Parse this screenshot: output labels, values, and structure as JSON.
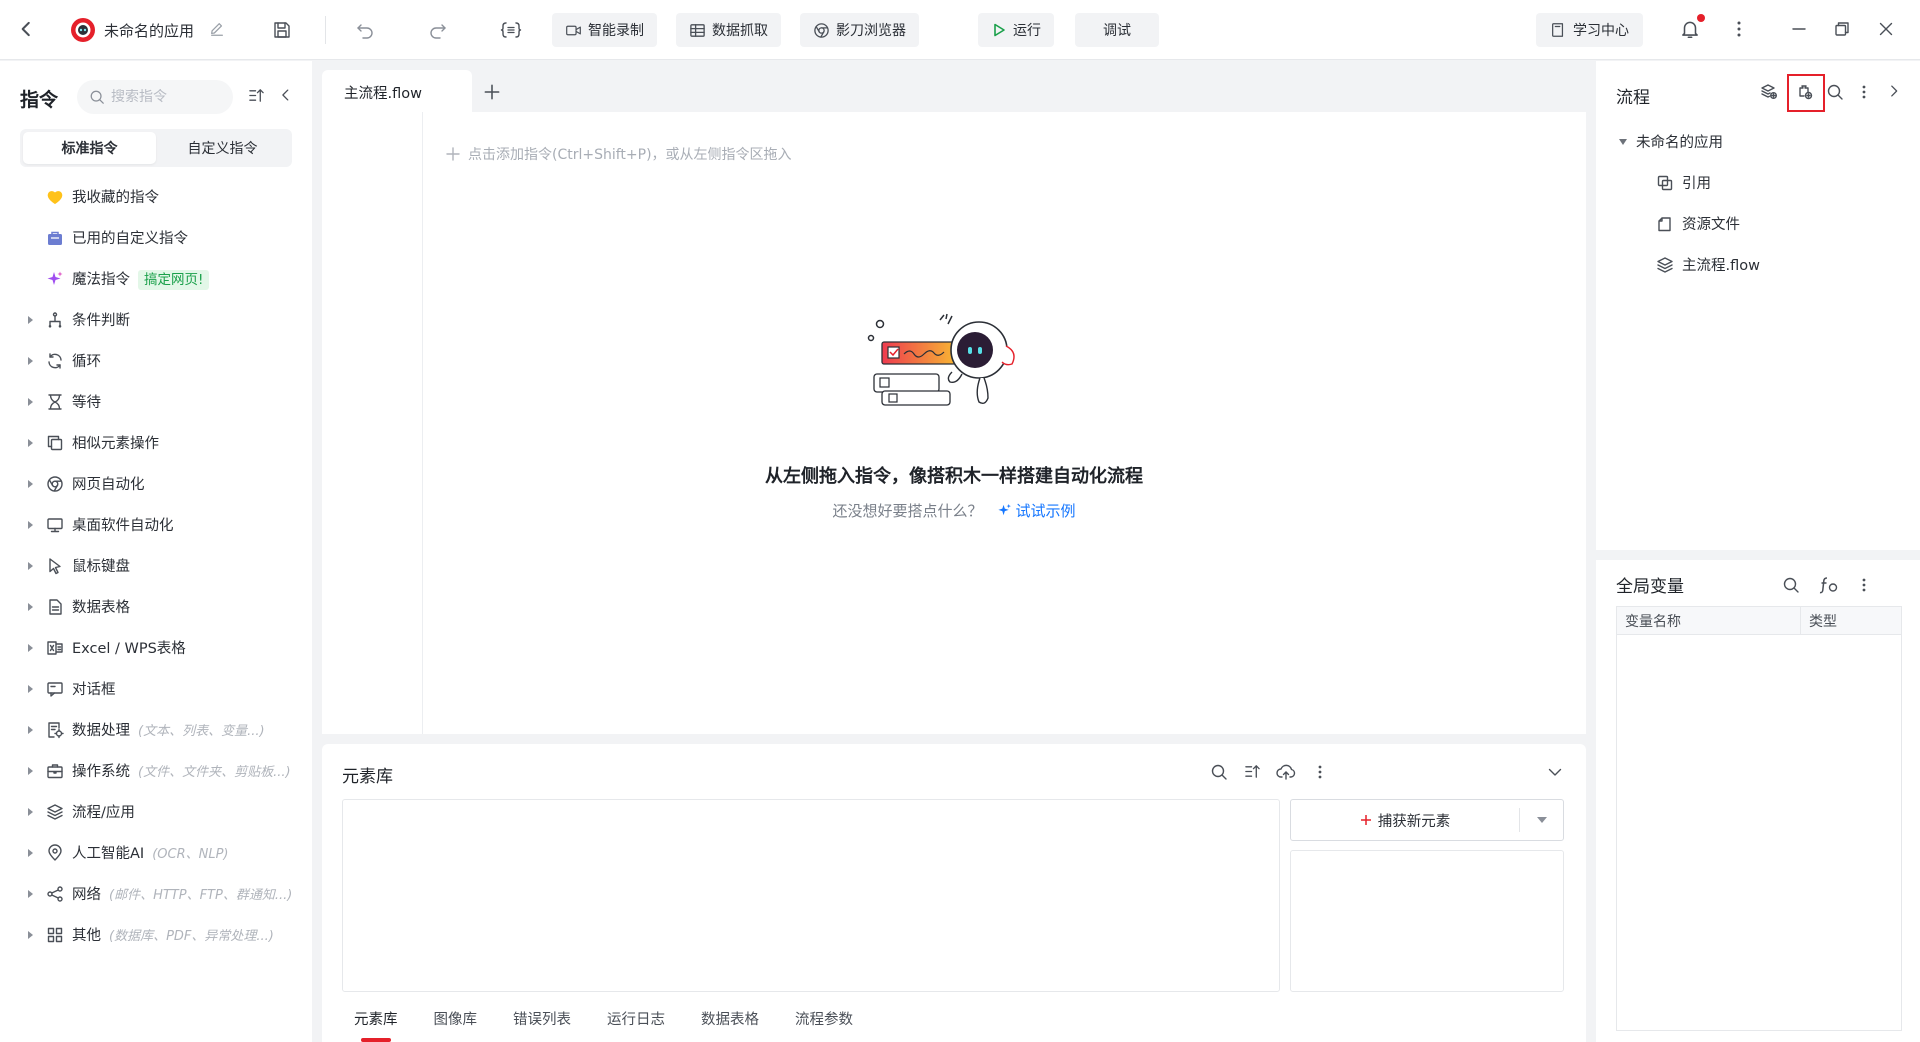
{
  "topbar": {
    "app_title": "未命名的应用",
    "buttons": {
      "smart_record": "智能录制",
      "data_capture": "数据抓取",
      "browser": "影刀浏览器",
      "run": "运行",
      "debug": "调试",
      "learning_center": "学习中心"
    },
    "notification_badge": true,
    "colors": {
      "accent": "#e5202a",
      "run_icon": "#1aa04a"
    }
  },
  "left_panel": {
    "title": "指令",
    "search_placeholder": "搜索指令",
    "segments": [
      "标准指令",
      "自定义指令"
    ],
    "active_segment": 0,
    "items": [
      {
        "label": "我收藏的指令",
        "icon": "heart-icon",
        "expandable": false
      },
      {
        "label": "已用的自定义指令",
        "icon": "bag-icon",
        "expandable": false
      },
      {
        "label": "魔法指令",
        "icon": "sparkle-icon",
        "expandable": false,
        "tag": "搞定网页!"
      },
      {
        "label": "条件判断",
        "icon": "branch-icon",
        "expandable": true
      },
      {
        "label": "循环",
        "icon": "loop-icon",
        "expandable": true
      },
      {
        "label": "等待",
        "icon": "hourglass-icon",
        "expandable": true
      },
      {
        "label": "相似元素操作",
        "icon": "copy-icon",
        "expandable": true
      },
      {
        "label": "网页自动化",
        "icon": "browser-icon",
        "expandable": true
      },
      {
        "label": "桌面软件自动化",
        "icon": "monitor-icon",
        "expandable": true
      },
      {
        "label": "鼠标键盘",
        "icon": "cursor-icon",
        "expandable": true
      },
      {
        "label": "数据表格",
        "icon": "document-icon",
        "expandable": true
      },
      {
        "label": "Excel / WPS表格",
        "icon": "excel-icon",
        "expandable": true
      },
      {
        "label": "对话框",
        "icon": "dialog-icon",
        "expandable": true
      },
      {
        "label": "数据处理",
        "icon": "data-process-icon",
        "expandable": true,
        "hint": "(文本、列表、变量...)"
      },
      {
        "label": "操作系统",
        "icon": "briefcase-icon",
        "expandable": true,
        "hint": "(文件、文件夹、剪贴板...)"
      },
      {
        "label": "流程/应用",
        "icon": "layers-icon",
        "expandable": true
      },
      {
        "label": "人工智能AI",
        "icon": "ai-icon",
        "expandable": true,
        "hint": "(OCR、NLP)"
      },
      {
        "label": "网络",
        "icon": "share-icon",
        "expandable": true,
        "hint": "(邮件、HTTP、FTP、群通知...)"
      },
      {
        "label": "其他",
        "icon": "grid-icon",
        "expandable": true,
        "hint": "(数据库、PDF、异常处理...)"
      }
    ]
  },
  "editor": {
    "tab_label": "主流程.flow",
    "add_hint": "点击添加指令(Ctrl+Shift+P)，或从左侧指令区拖入",
    "empty_title": "从左侧拖入指令，像搭积木一样搭建自动化流程",
    "empty_sub": "还没想好要搭点什么？",
    "try_example": "试试示例"
  },
  "element_library": {
    "title": "元素库",
    "capture_button": "捕获新元素",
    "tabs": [
      "元素库",
      "图像库",
      "错误列表",
      "运行日志",
      "数据表格",
      "流程参数"
    ],
    "active_tab": 0
  },
  "right_panel": {
    "flow_title": "流程",
    "tree_root": "未命名的应用",
    "tree_children": [
      {
        "label": "引用",
        "icon": "reference-icon"
      },
      {
        "label": "资源文件",
        "icon": "resource-icon"
      },
      {
        "label": "主流程.flow",
        "icon": "layers-icon"
      }
    ],
    "global_vars_title": "全局变量",
    "table_headers": [
      "变量名称",
      "类型"
    ]
  }
}
